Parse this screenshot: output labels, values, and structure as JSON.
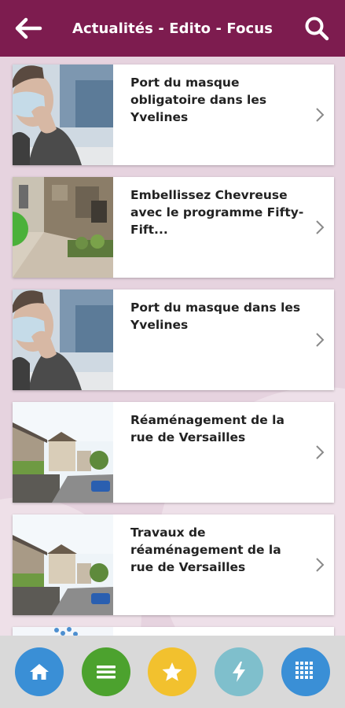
{
  "header": {
    "title": "Actualités - Edito - Focus",
    "back_icon": "arrow-left-icon",
    "search_icon": "search-icon",
    "background": "#7d1c4f"
  },
  "articles": [
    {
      "title": "Port du masque obligatoire dans les Yvelines",
      "image": "mask-photo"
    },
    {
      "title": "Embellissez Chevreuse avec le programme Fifty-Fift...",
      "image": "stone-street-photo"
    },
    {
      "title": "Port du masque dans les Yvelines",
      "image": "mask-photo"
    },
    {
      "title": "Réaménagement de la rue de Versailles",
      "image": "street-photo"
    },
    {
      "title": "Travaux de réaménagement de la rue de Versailles",
      "image": "street-photo"
    }
  ],
  "bottom_nav": [
    {
      "name": "home",
      "icon": "home-icon",
      "color": "#3a8fd6"
    },
    {
      "name": "menu",
      "icon": "menu-icon",
      "color": "#4ca22e"
    },
    {
      "name": "favorites",
      "icon": "star-icon",
      "color": "#f2c12e"
    },
    {
      "name": "alerts",
      "icon": "lightning-icon",
      "color": "#7fbfcc"
    },
    {
      "name": "apps",
      "icon": "grid-icon",
      "color": "#3a8fd6"
    }
  ]
}
